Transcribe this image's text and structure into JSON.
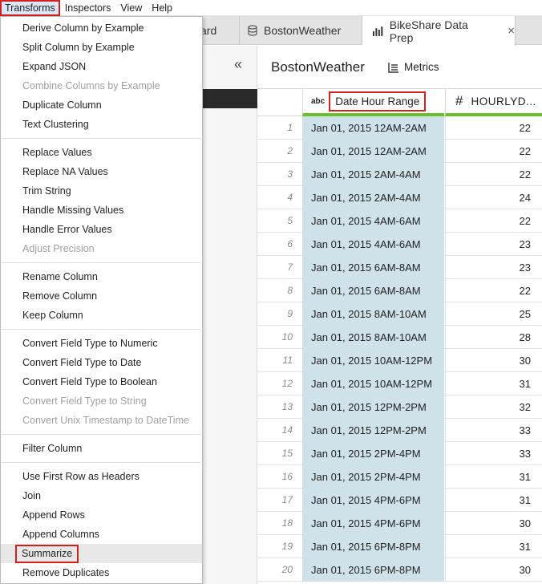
{
  "menubar": {
    "items": [
      "Transforms",
      "Inspectors",
      "View",
      "Help"
    ]
  },
  "tabs": {
    "partial": "ard",
    "boston": "BostonWeather",
    "bikeshare": "BikeShare Data Prep",
    "close": "×"
  },
  "header": {
    "title": "BostonWeather",
    "metrics": "Metrics",
    "collapse": "«"
  },
  "grid": {
    "col1_type": "abc",
    "col1_name": "Date Hour Range",
    "col2_type": "#",
    "col2_name": "HOURLYD...",
    "rows": [
      {
        "n": "1",
        "date": "Jan 01, 2015 12AM-2AM",
        "val": "22"
      },
      {
        "n": "2",
        "date": "Jan 01, 2015 12AM-2AM",
        "val": "22"
      },
      {
        "n": "3",
        "date": "Jan 01, 2015 2AM-4AM",
        "val": "22"
      },
      {
        "n": "4",
        "date": "Jan 01, 2015 2AM-4AM",
        "val": "24"
      },
      {
        "n": "5",
        "date": "Jan 01, 2015 4AM-6AM",
        "val": "22"
      },
      {
        "n": "6",
        "date": "Jan 01, 2015 4AM-6AM",
        "val": "23"
      },
      {
        "n": "7",
        "date": "Jan 01, 2015 6AM-8AM",
        "val": "23"
      },
      {
        "n": "8",
        "date": "Jan 01, 2015 6AM-8AM",
        "val": "22"
      },
      {
        "n": "9",
        "date": "Jan 01, 2015 8AM-10AM",
        "val": "25"
      },
      {
        "n": "10",
        "date": "Jan 01, 2015 8AM-10AM",
        "val": "28"
      },
      {
        "n": "11",
        "date": "Jan 01, 2015 10AM-12PM",
        "val": "30"
      },
      {
        "n": "12",
        "date": "Jan 01, 2015 10AM-12PM",
        "val": "31"
      },
      {
        "n": "13",
        "date": "Jan 01, 2015 12PM-2PM",
        "val": "32"
      },
      {
        "n": "14",
        "date": "Jan 01, 2015 12PM-2PM",
        "val": "33"
      },
      {
        "n": "15",
        "date": "Jan 01, 2015 2PM-4PM",
        "val": "33"
      },
      {
        "n": "16",
        "date": "Jan 01, 2015 2PM-4PM",
        "val": "31"
      },
      {
        "n": "17",
        "date": "Jan 01, 2015 4PM-6PM",
        "val": "31"
      },
      {
        "n": "18",
        "date": "Jan 01, 2015 4PM-6PM",
        "val": "30"
      },
      {
        "n": "19",
        "date": "Jan 01, 2015 6PM-8PM",
        "val": "31"
      },
      {
        "n": "20",
        "date": "Jan 01, 2015 6PM-8PM",
        "val": "30"
      }
    ]
  },
  "transforms_menu": {
    "groups": [
      [
        {
          "label": "Derive Column by Example",
          "enabled": true
        },
        {
          "label": "Split Column by Example",
          "enabled": true
        },
        {
          "label": "Expand JSON",
          "enabled": true
        },
        {
          "label": "Combine Columns by Example",
          "enabled": false
        },
        {
          "label": "Duplicate Column",
          "enabled": true
        },
        {
          "label": "Text Clustering",
          "enabled": true
        }
      ],
      [
        {
          "label": "Replace Values",
          "enabled": true
        },
        {
          "label": "Replace NA Values",
          "enabled": true
        },
        {
          "label": "Trim String",
          "enabled": true
        },
        {
          "label": "Handle Missing Values",
          "enabled": true
        },
        {
          "label": "Handle Error Values",
          "enabled": true
        },
        {
          "label": "Adjust Precision",
          "enabled": false
        }
      ],
      [
        {
          "label": "Rename Column",
          "enabled": true
        },
        {
          "label": "Remove Column",
          "enabled": true
        },
        {
          "label": "Keep Column",
          "enabled": true
        }
      ],
      [
        {
          "label": "Convert Field Type to Numeric",
          "enabled": true
        },
        {
          "label": "Convert Field Type to Date",
          "enabled": true
        },
        {
          "label": "Convert Field Type to Boolean",
          "enabled": true
        },
        {
          "label": "Convert Field Type to String",
          "enabled": false
        },
        {
          "label": "Convert Unix Timestamp to DateTime",
          "enabled": false
        }
      ],
      [
        {
          "label": "Filter Column",
          "enabled": true
        }
      ],
      [
        {
          "label": "Use First Row as Headers",
          "enabled": true
        },
        {
          "label": "Join",
          "enabled": true
        },
        {
          "label": "Append Rows",
          "enabled": true
        },
        {
          "label": "Append Columns",
          "enabled": true
        },
        {
          "label": "Summarize",
          "enabled": true,
          "highlighted": true
        },
        {
          "label": "Remove Duplicates",
          "enabled": true
        }
      ]
    ]
  },
  "colors": {
    "highlight_border": "#d21f1f",
    "column_selected_bg": "#cfe2ea",
    "column_quality_bar": "#6bbf2a"
  }
}
